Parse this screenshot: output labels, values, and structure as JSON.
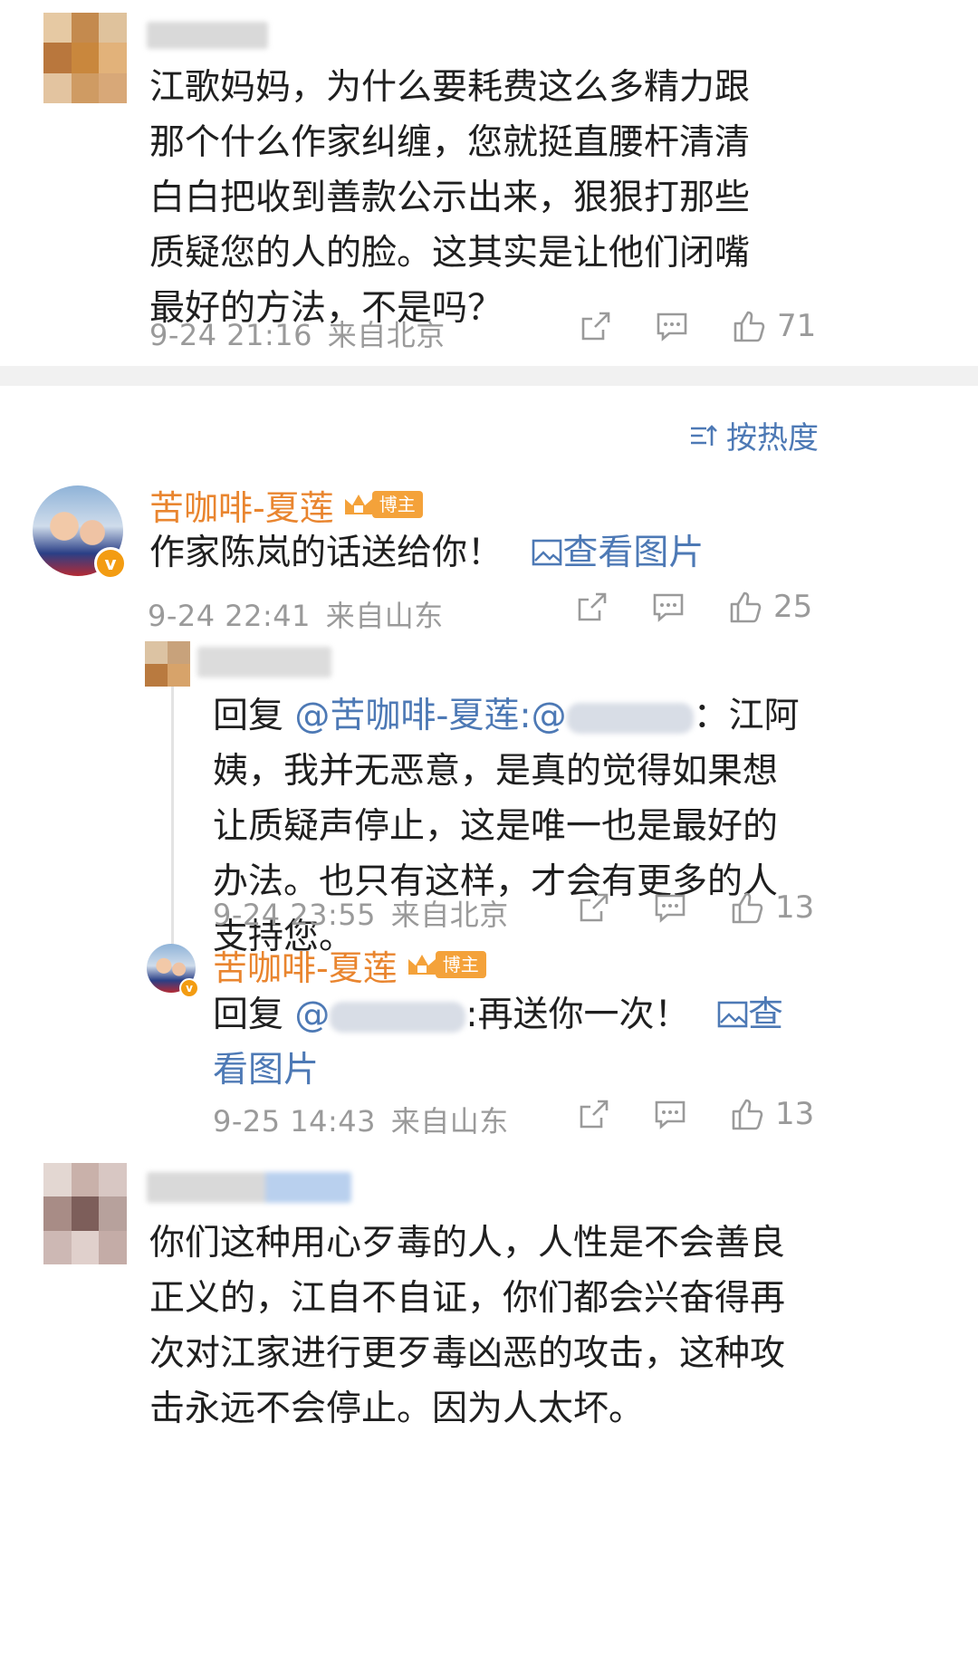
{
  "comments": [
    {
      "text": "江歌妈妈，为什么要耗费这么多精力跟那个什么作家纠缠，您就挺直腰杆清清白白把收到善款公示出来，狠狠打那些质疑您的人的脸。这其实是让他们闭嘴最好的方法，不是吗？",
      "time": "9-24 21:16",
      "location": "来自北京",
      "likes": "71"
    },
    {
      "author": "苦咖啡-夏莲",
      "badge": "博主",
      "text": "作家陈岚的话送给你！",
      "view_image": "查看图片",
      "time": "9-24 22:41",
      "location": "来自山东",
      "likes": "25"
    },
    {
      "reply_prefix": "回复",
      "mention": "@苦咖啡-夏莲",
      "mention_suffix": ":@",
      "text_after": "：江阿姨，我并无恶意，是真的觉得如果想让质疑声停止，这是唯一也是最好的办法。也只有这样，才会有更多的人支持您。",
      "time": "9-24 23:55",
      "location": "来自北京",
      "likes": "13"
    },
    {
      "author": "苦咖啡-夏莲",
      "badge": "博主",
      "reply_prefix": "回复",
      "mention_at": "@",
      "text_after": ":再送你一次！",
      "view_image": "查看图片",
      "time": "9-25 14:43",
      "location": "来自山东",
      "likes": "13"
    },
    {
      "text": "你们这种用心歹毒的人，人性是不会善良正义的，江自不自证，你们都会兴奋得再次对江家进行更歹毒凶恶的攻击，这种攻击永远不会停止。因为人太坏。"
    }
  ],
  "sort": {
    "label": "按热度",
    "icon": "sort-icon"
  },
  "colors": {
    "orange": "#e9852f",
    "link": "#4d79b5",
    "meta": "#9a9a9a",
    "badge": "#f4a23a"
  }
}
